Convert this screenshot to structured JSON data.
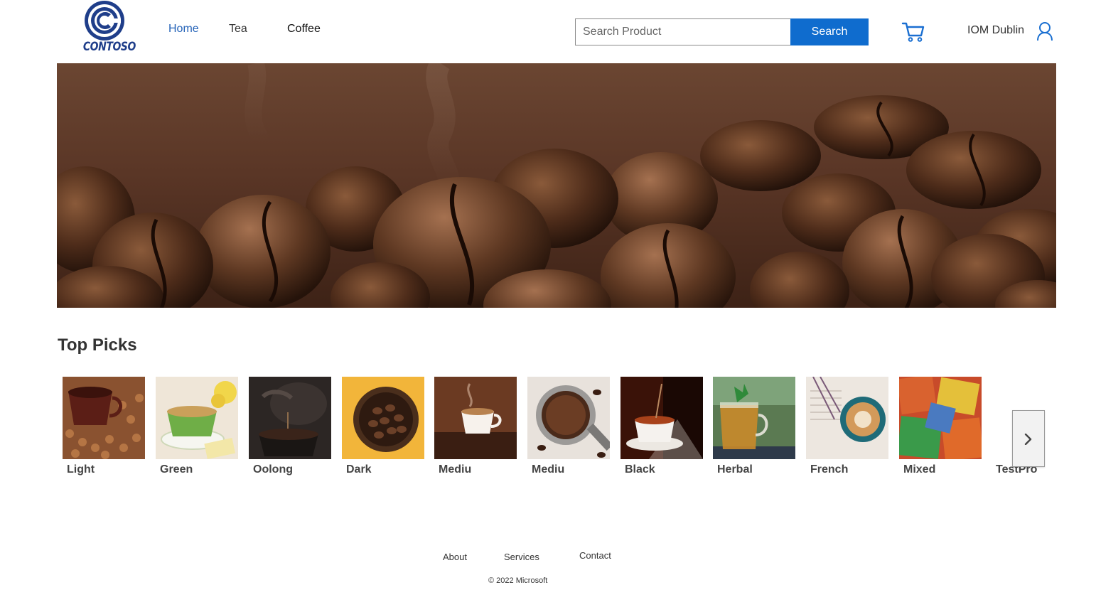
{
  "header": {
    "logo_text": "CONTOSO",
    "logo_color": "#1f3e8a",
    "nav": [
      {
        "label": "Home"
      },
      {
        "label": "Tea"
      },
      {
        "label": "Coffee"
      }
    ],
    "search": {
      "placeholder": "Search Product",
      "value": "",
      "button_label": "Search",
      "button_color": "#0f6cce"
    },
    "cart_icon": "shopping-cart-icon",
    "user": {
      "name": "IOM Dublin",
      "icon": "user-icon"
    }
  },
  "hero": {
    "icon": "coffee-beans-banner"
  },
  "top_picks": {
    "title": "Top Picks",
    "items": [
      {
        "label": "Light"
      },
      {
        "label": "Green"
      },
      {
        "label": "Oolong"
      },
      {
        "label": "Dark"
      },
      {
        "label": "Mediu"
      },
      {
        "label": "Mediu"
      },
      {
        "label": "Black"
      },
      {
        "label": "Herbal"
      },
      {
        "label": "French"
      },
      {
        "label": "Mixed"
      },
      {
        "label": "TestPro"
      }
    ],
    "next_icon": "chevron-right-icon"
  },
  "footer": {
    "links": [
      {
        "label": "About"
      },
      {
        "label": "Services"
      },
      {
        "label": "Contact"
      }
    ],
    "copyright": "© 2022 Microsoft"
  }
}
